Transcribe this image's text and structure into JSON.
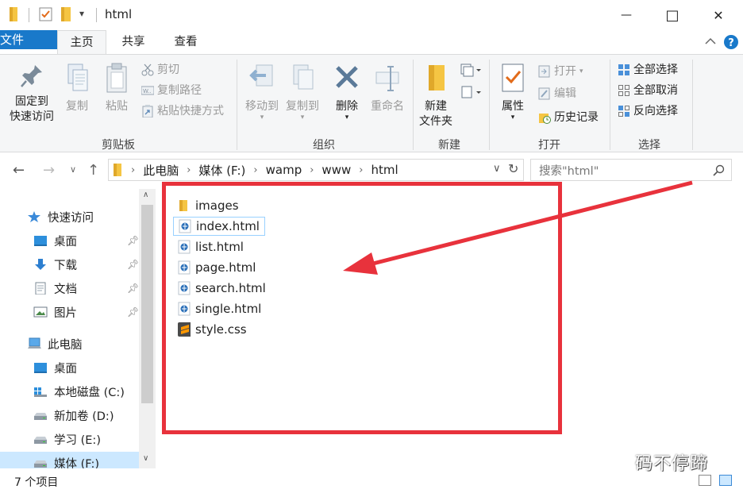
{
  "titlebar": {
    "title": "html",
    "dropdown_glyph": "▾",
    "controls": {
      "minimize": "—",
      "maximize": "□",
      "close": "✕"
    }
  },
  "tabs": {
    "file": "文件",
    "home": "主页",
    "share": "共享",
    "view": "查看"
  },
  "ribbon": {
    "clipboard": {
      "pin": [
        "固定到",
        "快速访问"
      ],
      "copy": "复制",
      "paste": "粘贴",
      "cut": "剪切",
      "copy_path": "复制路径",
      "paste_shortcut": "粘贴快捷方式",
      "label": "剪贴板"
    },
    "organize": {
      "move_to": "移动到",
      "copy_to": "复制到",
      "delete": "删除",
      "rename": "重命名",
      "label": "组织"
    },
    "new": {
      "new_folder": [
        "新建",
        "文件夹"
      ],
      "label": "新建"
    },
    "open": {
      "properties": "属性",
      "open": "打开",
      "edit": "编辑",
      "history": "历史记录",
      "label": "打开"
    },
    "select": {
      "select_all": "全部选择",
      "select_none": "全部取消",
      "invert": "反向选择",
      "label": "选择"
    }
  },
  "address": {
    "crumbs": [
      "此电脑",
      "媒体 (F:)",
      "wamp",
      "www",
      "html"
    ],
    "search_placeholder": "搜索\"html\""
  },
  "navpane": {
    "items": [
      {
        "label": "快速访问",
        "icon": "star-icon",
        "pinned": false
      },
      {
        "label": "桌面",
        "icon": "desktop-icon",
        "pinned": true
      },
      {
        "label": "下载",
        "icon": "download-icon",
        "pinned": true
      },
      {
        "label": "文档",
        "icon": "document-icon",
        "pinned": true
      },
      {
        "label": "图片",
        "icon": "picture-icon",
        "pinned": true
      },
      {
        "label": "此电脑",
        "icon": "computer-icon",
        "pinned": false
      },
      {
        "label": "桌面",
        "icon": "desktop-icon",
        "pinned": false
      },
      {
        "label": "本地磁盘 (C:)",
        "icon": "windows-drive-icon",
        "pinned": false
      },
      {
        "label": "新加卷 (D:)",
        "icon": "drive-icon",
        "pinned": false
      },
      {
        "label": "学习 (E:)",
        "icon": "drive-icon",
        "pinned": false
      },
      {
        "label": "媒体 (F:)",
        "icon": "drive-icon",
        "pinned": false
      }
    ]
  },
  "files": [
    {
      "name": "images",
      "type": "folder"
    },
    {
      "name": "index.html",
      "type": "html"
    },
    {
      "name": "list.html",
      "type": "html"
    },
    {
      "name": "page.html",
      "type": "html"
    },
    {
      "name": "search.html",
      "type": "html"
    },
    {
      "name": "single.html",
      "type": "html"
    },
    {
      "name": "style.css",
      "type": "css"
    }
  ],
  "status": {
    "count": "7 个项目"
  },
  "watermark": "码不停蹄",
  "colors": {
    "accent": "#1979ca",
    "selection": "#cce8ff",
    "annotation": "#e8323c",
    "folder": "#f5c543"
  }
}
